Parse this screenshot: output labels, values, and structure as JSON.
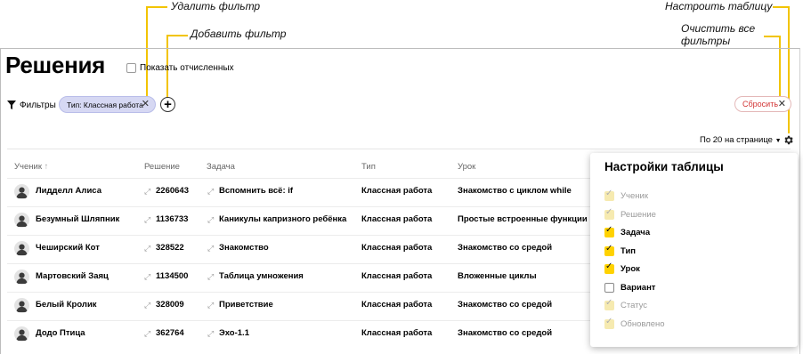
{
  "annotations": {
    "remove_filter": "Удалить фильтр",
    "add_filter": "Добавить фильтр",
    "configure_table": "Настроить таблицу",
    "clear_all_1": "Очистить все",
    "clear_all_2": "фильтры"
  },
  "page": {
    "title": "Решения",
    "show_expelled": "Показать отчисленных"
  },
  "filters": {
    "label": "Фильтры",
    "chip": "Тип: Классная работа",
    "reset": "Сбросить"
  },
  "per_page": "По 20 на странице",
  "table": {
    "headers": [
      "Ученик",
      "Решение",
      "Задача",
      "Тип",
      "Урок"
    ],
    "rows": [
      {
        "student": "Лидделл Алиса",
        "solution": "2260643",
        "task": "Вспомнить всё: if",
        "type": "Классная работа",
        "lesson": "Знакомство с циклом while"
      },
      {
        "student": "Безумный Шляпник",
        "solution": "1136733",
        "task": "Каникулы капризного ребёнка",
        "type": "Классная работа",
        "lesson": "Простые встроенные функции"
      },
      {
        "student": "Чеширский Кот",
        "solution": "328522",
        "task": "Знакомство",
        "type": "Классная работа",
        "lesson": "Знакомство со средой"
      },
      {
        "student": "Мартовский Заяц",
        "solution": "1134500",
        "task": "Таблица умножения",
        "type": "Классная работа",
        "lesson": "Вложенные циклы"
      },
      {
        "student": "Белый Кролик",
        "solution": "328009",
        "task": "Приветствие",
        "type": "Классная работа",
        "lesson": "Знакомство со средой"
      },
      {
        "student": "Додо Птица",
        "solution": "362764",
        "task": "Эхо-1.1",
        "type": "Классная работа",
        "lesson": "Знакомство со средой"
      }
    ]
  },
  "settings_panel": {
    "title": "Настройки таблицы",
    "options": [
      {
        "label": "Ученик",
        "state": "disabled"
      },
      {
        "label": "Решение",
        "state": "disabled"
      },
      {
        "label": "Задача",
        "state": "checked"
      },
      {
        "label": "Тип",
        "state": "checked"
      },
      {
        "label": "Урок",
        "state": "checked"
      },
      {
        "label": "Вариант",
        "state": "unchecked"
      },
      {
        "label": "Статус",
        "state": "disabled"
      },
      {
        "label": "Обновлено",
        "state": "disabled"
      }
    ]
  },
  "colors": {
    "annotation_line": "#f2c400",
    "chip_bg": "#d6d8f3",
    "reset_text": "#d23434",
    "checkbox_on": "#ffd200"
  }
}
